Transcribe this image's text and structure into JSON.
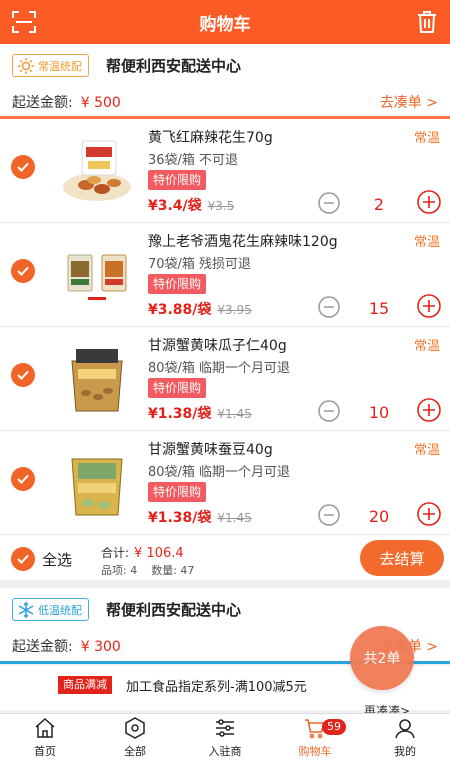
{
  "header": {
    "title": "购物车"
  },
  "stores": [
    {
      "tag": "常温统配",
      "name": "帮便利西安配送中心",
      "min_label": "起送金额:",
      "min_amount": "¥ 500",
      "more_link": "去凑单 >",
      "items": [
        {
          "name": "黄飞红麻辣花生70g",
          "temp": "常温",
          "spec": "36袋/箱 不可退",
          "promo": "特价限购",
          "price": "¥3.4/袋",
          "orig": "¥3.5",
          "qty": "2"
        },
        {
          "name": "豫上老爷酒鬼花生麻辣味120g",
          "temp": "常温",
          "spec": "70袋/箱 残损可退",
          "promo": "特价限购",
          "price": "¥3.88/袋",
          "orig": "¥3.95",
          "qty": "15"
        },
        {
          "name": "甘源蟹黄味瓜子仁40g",
          "temp": "常温",
          "spec": "80袋/箱 临期一个月可退",
          "promo": "特价限购",
          "price": "¥1.38/袋",
          "orig": "¥1.45",
          "qty": "10"
        },
        {
          "name": "甘源蟹黄味蚕豆40g",
          "temp": "常温",
          "spec": "80袋/箱 临期一个月可退",
          "promo": "特价限购",
          "price": "¥1.38/袋",
          "orig": "¥1.45",
          "qty": "20"
        }
      ],
      "select_all": "全选",
      "total_label": "合计:",
      "total": "¥ 106.4",
      "item_count": "品项: 4",
      "qty_count": "数量: 47",
      "checkout": "去结算"
    },
    {
      "tag": "低温统配",
      "name": "帮便利西安配送中心",
      "min_label": "起送金额:",
      "min_amount": "¥ 300",
      "more_link": "去凑单 >"
    }
  ],
  "promotion": {
    "badge": "商品满减",
    "text": "加工食品指定系列-满100减5元",
    "more": "再凑凑>"
  },
  "float_button": "共2单",
  "tabbar": {
    "tabs": [
      {
        "label": "首页",
        "icon": "home-icon"
      },
      {
        "label": "全部",
        "icon": "all-icon"
      },
      {
        "label": "入驻商",
        "icon": "merchant-icon"
      },
      {
        "label": "购物车",
        "icon": "cart-icon",
        "badge": "59",
        "active": true
      },
      {
        "label": "我的",
        "icon": "profile-icon"
      }
    ]
  },
  "colors": {
    "accent": "#fb5b24",
    "price": "#e2231a",
    "cold": "#2aa4dc",
    "warm": "#f39a32"
  }
}
